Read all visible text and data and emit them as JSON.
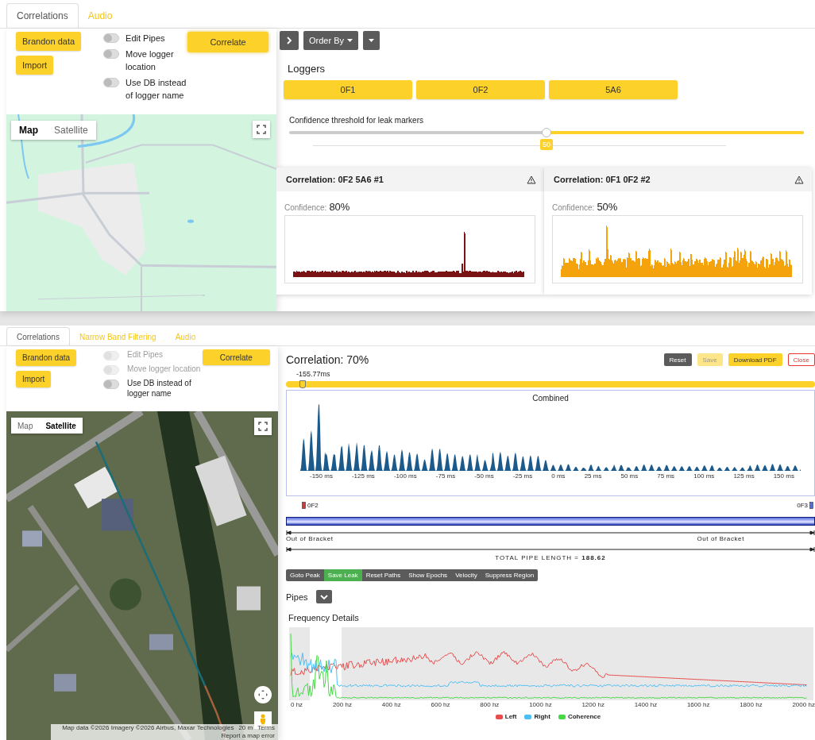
{
  "top_view": {
    "tabs": [
      {
        "label": "Correlations",
        "selected": true
      },
      {
        "label": "Audio",
        "selected": false
      }
    ],
    "controls": {
      "buttons": [
        "Brandon data",
        "Import"
      ],
      "toggles": [
        {
          "label": "Edit Pipes",
          "on": false,
          "disabled": false
        },
        {
          "label": "Move logger location",
          "on": false,
          "disabled": false
        },
        {
          "label": "Use DB instead of logger name",
          "on": false,
          "disabled": false
        }
      ],
      "correlate": "Correlate"
    },
    "map": {
      "kind": "roadmap",
      "types": [
        {
          "label": "Map",
          "selected": true
        },
        {
          "label": "Satellite",
          "selected": false
        }
      ],
      "camera_control": false,
      "street_view": false
    },
    "order_by": "Order By",
    "loggers": {
      "title": "Loggers",
      "items": [
        "0F1",
        "0F2",
        "5A6"
      ]
    },
    "threshold": {
      "label": "Confidence threshold for leak markers",
      "level": 0.5,
      "value": "50"
    },
    "correlations": [
      {
        "title": "Correlation: 0F2 5A6 #1",
        "confidence_label": "Confidence:",
        "confidence": "80%",
        "kind": "spike",
        "color": "#7a1414"
      },
      {
        "title": "Correlation: 0F1 0F2 #2",
        "confidence_label": "Confidence:",
        "confidence": "50%",
        "kind": "noisy",
        "color": "#f5a30c"
      }
    ]
  },
  "bottom_view": {
    "tabs": [
      {
        "label": "Correlations",
        "selected": true
      },
      {
        "label": "Narrow Band Filtering",
        "selected": false
      },
      {
        "label": "Audio",
        "selected": false
      }
    ],
    "controls": {
      "buttons": [
        "Brandon data",
        "Import"
      ],
      "toggles": [
        {
          "label": "Edit Pipes",
          "on": false,
          "disabled": true
        },
        {
          "label": "Move logger location",
          "on": false,
          "disabled": true
        },
        {
          "label": "Use DB instead of logger name",
          "on": false,
          "disabled": false
        }
      ],
      "correlate": "Correlate"
    },
    "map": {
      "kind": "satellite",
      "types": [
        {
          "label": "Map",
          "selected": false
        },
        {
          "label": "Satellite",
          "selected": true
        }
      ],
      "camera_control": true,
      "street_view": true,
      "attribution": [
        "Map data ©2026 Imagery ©2026 Airbus, Maxar Technologies",
        "20 m",
        "Terms",
        "Report a map error"
      ]
    },
    "correlation": {
      "title": "Correlation: 70%",
      "actions": [
        {
          "label": "Reset",
          "kind": "dark"
        },
        {
          "label": "Save",
          "kind": "disabled"
        },
        {
          "label": "Download PDF",
          "kind": "primary"
        },
        {
          "label": "Close",
          "kind": "danger"
        }
      ],
      "offset": {
        "label": "-155.77ms",
        "level": 0.03
      }
    },
    "combined": {
      "title": "Combined",
      "xticks": [
        "-150 ms",
        "-125 ms",
        "-100 ms",
        "-75 ms",
        "-50 ms",
        "-25 ms",
        "0 ms",
        "25 ms",
        "50 ms",
        "75 ms",
        "100 ms",
        "125 ms",
        "150 ms"
      ]
    },
    "pipe": {
      "left": "0F2",
      "right": "0F3",
      "brackets": [
        "Out of Bracket",
        "Out of Bracket"
      ],
      "total": "TOTAL PIPE LENGTH = **188.62**"
    },
    "tools": [
      {
        "label": "Goto Peak",
        "selected": false
      },
      {
        "label": "Save Leak",
        "selected": true
      },
      {
        "label": "Reset Paths",
        "selected": false
      },
      {
        "label": "Show Epochs",
        "selected": false
      },
      {
        "label": "Velocity",
        "selected": false
      },
      {
        "label": "Suppress Region",
        "selected": false
      }
    ],
    "pipes_label": "Pipes",
    "frequency": {
      "title": "Frequency Details",
      "xticks": [
        "0 hz",
        "200 hz",
        "400 hz",
        "600 hz",
        "800 hz",
        "1000 hz",
        "1200 hz",
        "1400 hz",
        "1600 hz",
        "1800 hz",
        "2000 hz"
      ],
      "legend": [
        {
          "label": "Left",
          "color": "#e84c4c"
        },
        {
          "label": "Right",
          "color": "#4dbff5"
        },
        {
          "label": "Coherence",
          "color": "#45d945"
        }
      ]
    }
  }
}
